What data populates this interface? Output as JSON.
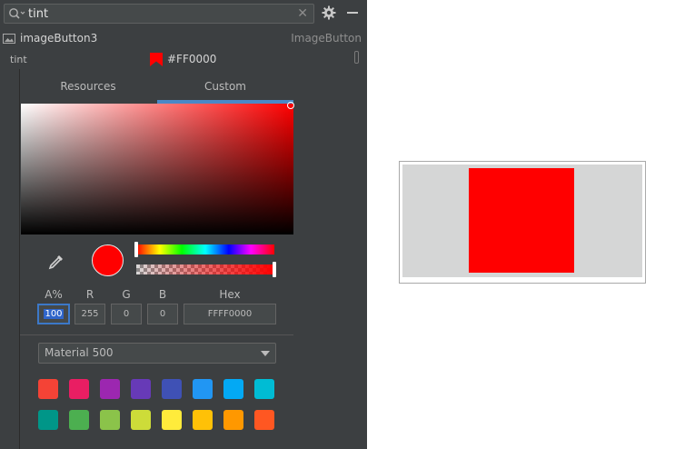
{
  "search": {
    "value": "tint",
    "placeholder": ""
  },
  "component": {
    "name": "imageButton3",
    "type": "ImageButton"
  },
  "attribute": {
    "name": "tint",
    "value": "#FF0000",
    "swatch_color": "#ff0000"
  },
  "picker": {
    "tabs": [
      {
        "label": "Resources"
      },
      {
        "label": "Custom"
      }
    ],
    "active_tab": "Custom",
    "current_color": "#ff0000",
    "fields": {
      "alpha": {
        "label": "A%",
        "value": "100"
      },
      "r": {
        "label": "R",
        "value": "255"
      },
      "g": {
        "label": "G",
        "value": "0"
      },
      "b": {
        "label": "B",
        "value": "0"
      },
      "hex": {
        "label": "Hex",
        "value": "FFFF0000"
      }
    },
    "hue_fraction": 0.0,
    "alpha_fraction": 1.0,
    "palette": {
      "selected": "Material 500"
    },
    "swatches": [
      "#f44336",
      "#e91e63",
      "#9c27b0",
      "#673ab7",
      "#3f51b5",
      "#2196f3",
      "#03a9f4",
      "#00bcd4",
      "#009688",
      "#4caf50",
      "#8bc34a",
      "#cddc39",
      "#ffeb3b",
      "#ffc107",
      "#ff9800",
      "#ff5722"
    ]
  },
  "preview": {
    "background": "#d5d6d6",
    "tint": "#ff0000"
  },
  "icons": {
    "search": "search-icon",
    "clear": "close-icon",
    "settings": "gear-icon",
    "collapse": "minimize-icon",
    "component": "image-icon",
    "eyedropper": "eyedropper-icon",
    "dropdown": "chevron-down-icon"
  }
}
